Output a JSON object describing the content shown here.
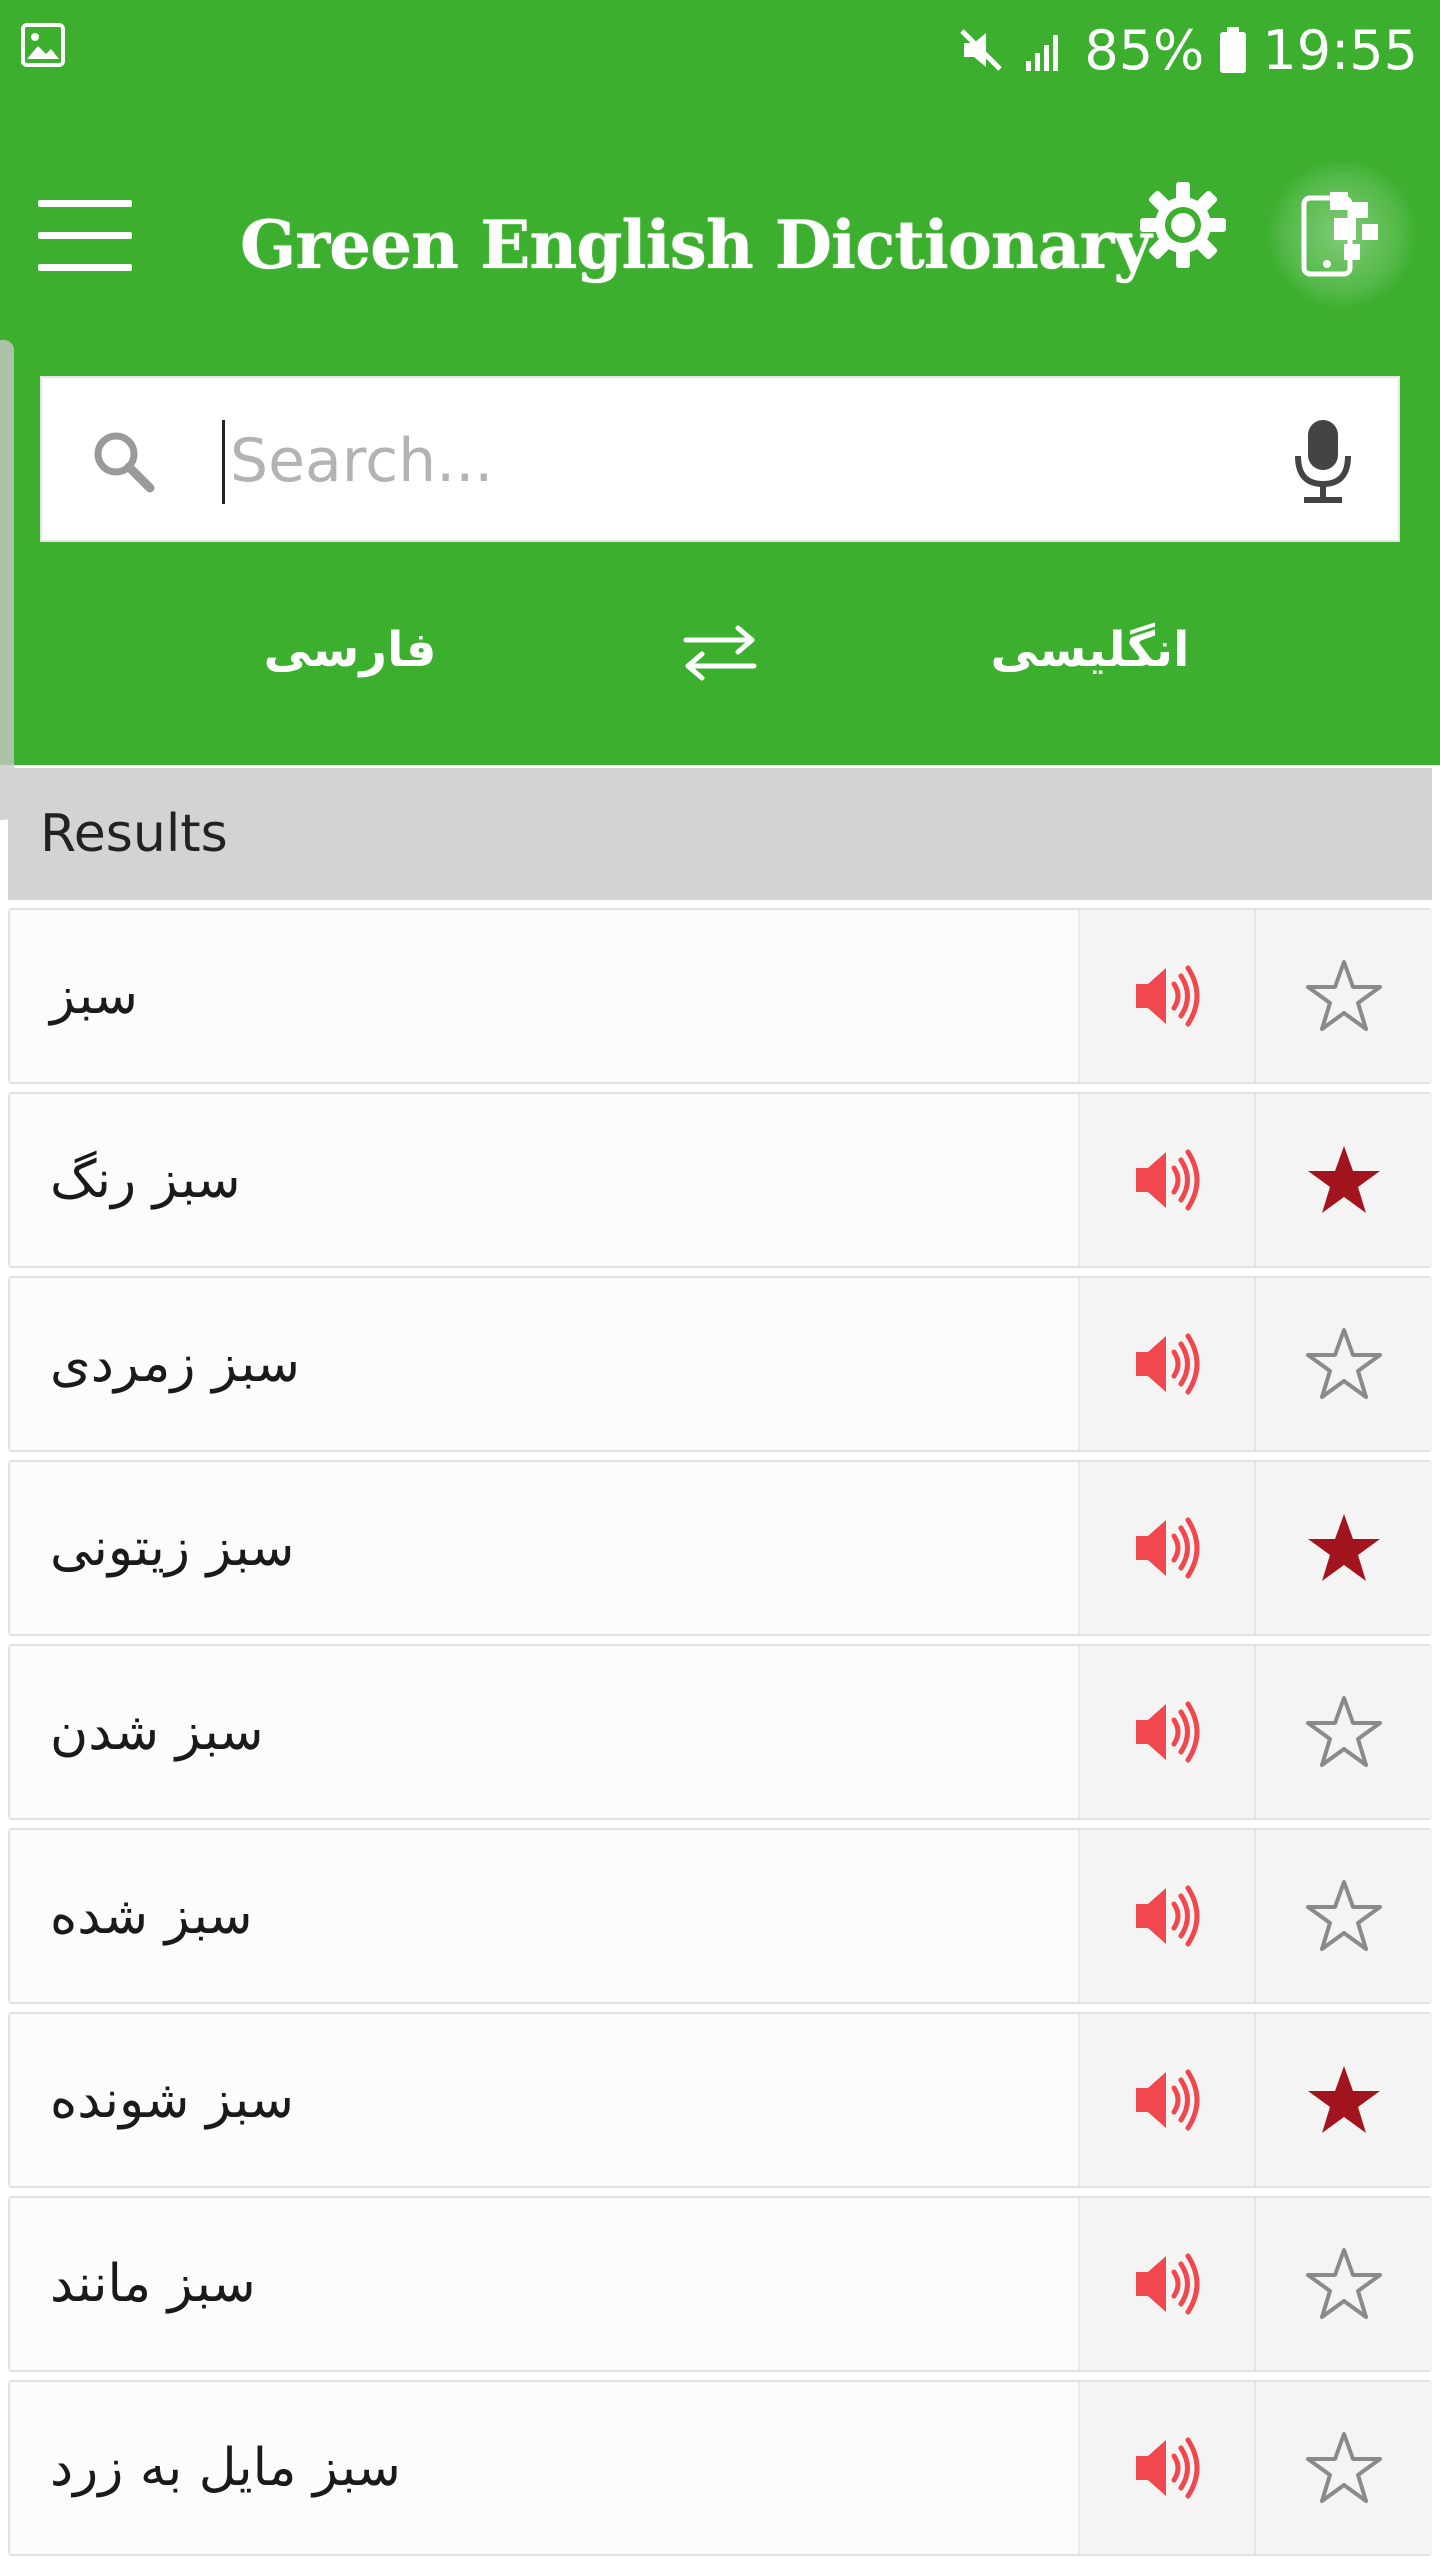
{
  "status_bar": {
    "battery_percent": "85%",
    "time": "19:55",
    "left_icon": "image-notification-icon",
    "icons": [
      "mute-icon",
      "signal-icon",
      "battery-icon"
    ]
  },
  "app_bar": {
    "title": "Green English Dictionary",
    "menu_icon": "hamburger-menu-icon",
    "settings_icon": "gear-icon",
    "share_icon": "share-app-icon",
    "background_color": "#3caf2f"
  },
  "search": {
    "placeholder": "Search...",
    "value": "",
    "search_icon": "search-icon",
    "mic_icon": "microphone-icon"
  },
  "languages": {
    "from": "فارسی",
    "to": "انگلیسی",
    "swap_icon": "swap-arrows-icon"
  },
  "results": {
    "header": "Results",
    "items": [
      {
        "word": "سبز",
        "favorite": false
      },
      {
        "word": "سبز رنگ",
        "favorite": true
      },
      {
        "word": "سبز زمردی",
        "favorite": false
      },
      {
        "word": "سبز زیتونی",
        "favorite": true
      },
      {
        "word": "سبز شدن",
        "favorite": false
      },
      {
        "word": "سبز شده",
        "favorite": false
      },
      {
        "word": "سبز شونده",
        "favorite": true
      },
      {
        "word": "سبز مانند",
        "favorite": false
      },
      {
        "word": "سبز مایل به زرد",
        "favorite": false
      }
    ],
    "speaker_color": "#f0484e",
    "star_filled_color": "#a3151e",
    "star_empty_color": "#8a8a8a"
  }
}
